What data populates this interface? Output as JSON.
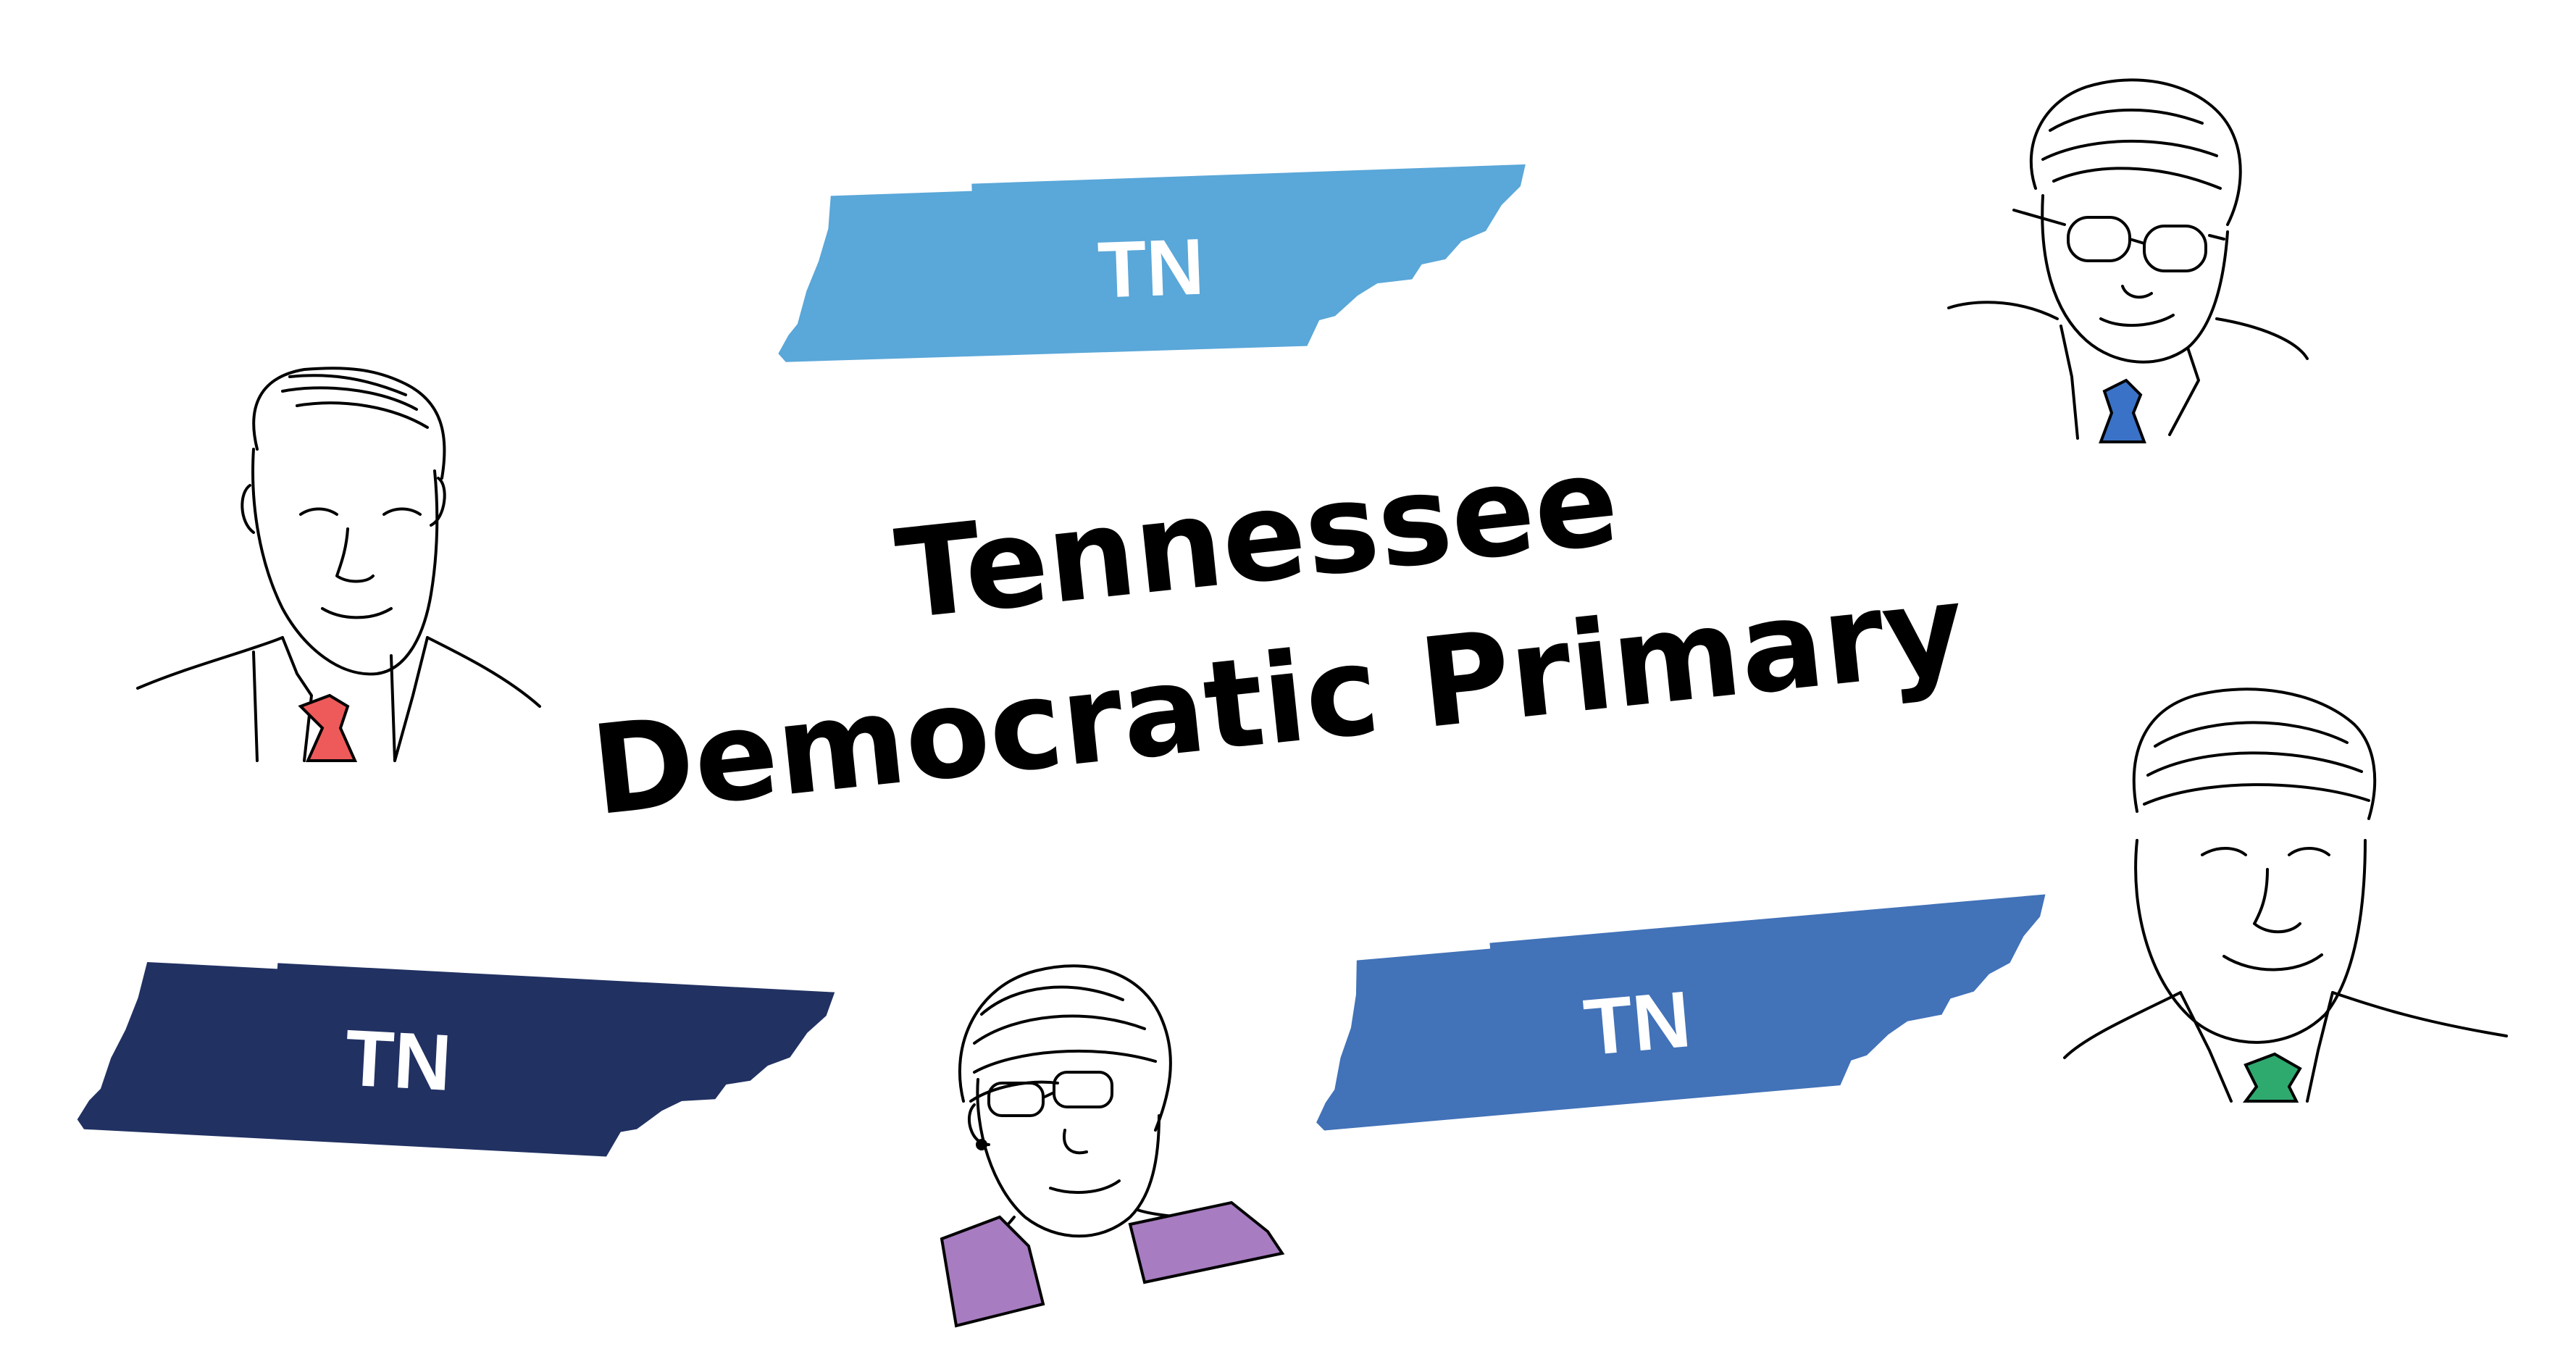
{
  "title": {
    "line1": "Tennessee",
    "line2": "Democratic Primary"
  },
  "state_shapes": [
    {
      "label": "TN",
      "color": "#5aa7d9"
    },
    {
      "label": "TN",
      "color": "#213162"
    },
    {
      "label": "TN",
      "color": "#4272b8"
    }
  ],
  "portraits": [
    {
      "icon": "portrait-red-tie-icon",
      "tie_color": "#ee5a5a"
    },
    {
      "icon": "portrait-glasses-blue-tie-icon",
      "tie_color": "#3a72c7"
    },
    {
      "icon": "portrait-woman-purple-jacket-icon",
      "jacket_color": "#a77cc0"
    },
    {
      "icon": "portrait-green-tie-icon",
      "tie_color": "#2faa6f"
    }
  ],
  "colors": {
    "background": "#ffffff",
    "text": "#000000"
  }
}
